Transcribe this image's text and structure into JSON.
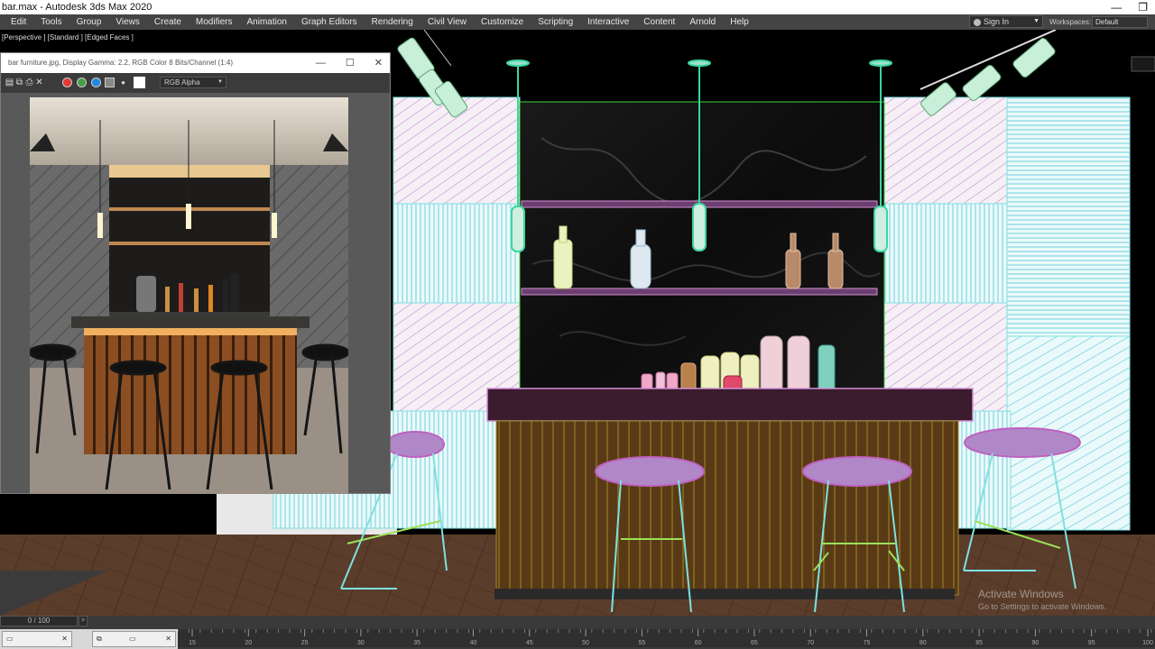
{
  "window": {
    "title": "bar.max - Autodesk 3ds Max 2020"
  },
  "menus": [
    "Edit",
    "Tools",
    "Group",
    "Views",
    "Create",
    "Modifiers",
    "Animation",
    "Graph Editors",
    "Rendering",
    "Civil View",
    "Customize",
    "Scripting",
    "Interactive",
    "Content",
    "Arnold",
    "Help"
  ],
  "account": {
    "sign_in": "Sign In",
    "workspaces_label": "Workspaces:",
    "workspace": "Default"
  },
  "viewport": {
    "label": "[Perspective ] [Standard ] [Edged Faces ]"
  },
  "frame_buffer": {
    "title": "bar furniture.jpg, Display Gamma: 2.2, RGB Color 8 Bits/Channel (1:4)",
    "channel": "RGB Alpha",
    "channel_colors": [
      "#e53935",
      "#43a047",
      "#1e88e5"
    ]
  },
  "timeline": {
    "frame_counter": "0 / 100",
    "next": ">",
    "ticks": [
      15,
      20,
      25,
      30,
      35,
      40,
      45,
      50,
      55,
      60,
      65,
      70,
      75,
      80,
      85,
      90,
      95,
      100
    ]
  },
  "watermark": {
    "line1": "Activate Windows",
    "line2": "Go to Settings to activate Windows."
  },
  "colors": {
    "menu_bg": "#444444",
    "wire_cyan": "#7fe0e0",
    "wire_pink": "#d48fd4",
    "wire_green": "#9be05a",
    "counter_top": "#3a1c2e",
    "floor": "#5a3d2b"
  }
}
